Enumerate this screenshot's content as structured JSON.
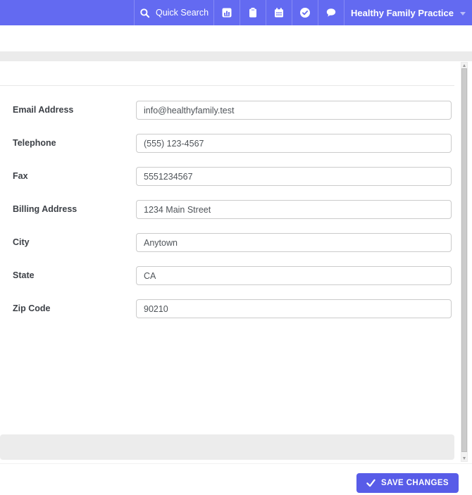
{
  "topbar": {
    "quick_search": {
      "label": "Quick Search",
      "icon": "search-icon"
    },
    "nav_icons": [
      {
        "name": "reports-icon"
      },
      {
        "name": "clipboard-icon"
      },
      {
        "name": "calendar-icon"
      },
      {
        "name": "tasks-check-icon"
      },
      {
        "name": "messages-icon"
      }
    ],
    "practice_menu": {
      "label": "Healthy Family Practice",
      "icon": "chevron-down-icon"
    }
  },
  "form": {
    "fields": [
      {
        "label": "Email Address",
        "value": "info@healthyfamily.test"
      },
      {
        "label": "Telephone",
        "value": "(555) 123-4567"
      },
      {
        "label": "Fax",
        "value": "5551234567"
      },
      {
        "label": "Billing Address",
        "value": "1234 Main Street"
      },
      {
        "label": "City",
        "value": "Anytown"
      },
      {
        "label": "State",
        "value": "CA"
      },
      {
        "label": "Zip Code",
        "value": "90210"
      }
    ]
  },
  "footer": {
    "save_button": {
      "label": "SAVE CHANGES",
      "icon": "check-icon"
    }
  },
  "colors": {
    "topbar_bg": "#636af1",
    "accent_button": "#585ce8",
    "gray_band": "#ebebeb",
    "card_footer_strip": "#ececec"
  }
}
